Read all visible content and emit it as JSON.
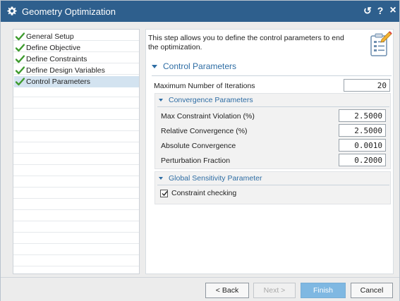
{
  "window": {
    "title": "Geometry Optimization",
    "titlebar_color": "#2e5f8d",
    "controls": {
      "reset_glyph": "↺",
      "help_glyph": "?",
      "close_glyph": "×"
    }
  },
  "steps": [
    {
      "label": "General Setup",
      "status": "complete",
      "icon": "check-icon"
    },
    {
      "label": "Define Objective",
      "status": "complete",
      "icon": "check-icon"
    },
    {
      "label": "Define Constraints",
      "status": "complete",
      "icon": "check-icon"
    },
    {
      "label": "Define Design Variables",
      "status": "complete",
      "icon": "check-icon"
    },
    {
      "label": "Control Parameters",
      "status": "active",
      "icon": "check-icon"
    }
  ],
  "main": {
    "intro_text": "This step allows you to define the control parameters to end the optimization.",
    "section_title": "Control Parameters",
    "max_iterations": {
      "label": "Maximum Number of Iterations",
      "value": "20"
    },
    "convergence": {
      "title": "Convergence Parameters",
      "fields": [
        {
          "label": "Max Constraint Violation (%)",
          "value": "2.5000"
        },
        {
          "label": "Relative Convergence (%)",
          "value": "2.5000"
        },
        {
          "label": "Absolute Convergence",
          "value": "0.0010"
        },
        {
          "label": "Perturbation Fraction",
          "value": "0.2000"
        }
      ]
    },
    "sensitivity": {
      "title": "Global Sensitivity Parameter",
      "constraint_checking": {
        "label": "Constraint checking",
        "checked": true
      }
    }
  },
  "buttons": {
    "back": "< Back",
    "next": "Next >",
    "finish": "Finish",
    "cancel": "Cancel"
  },
  "colors": {
    "accent": "#2e6da4",
    "check_green": "#3e9b2e",
    "finish_button": "#7fb8e2",
    "active_step": "#d3e3f0"
  }
}
